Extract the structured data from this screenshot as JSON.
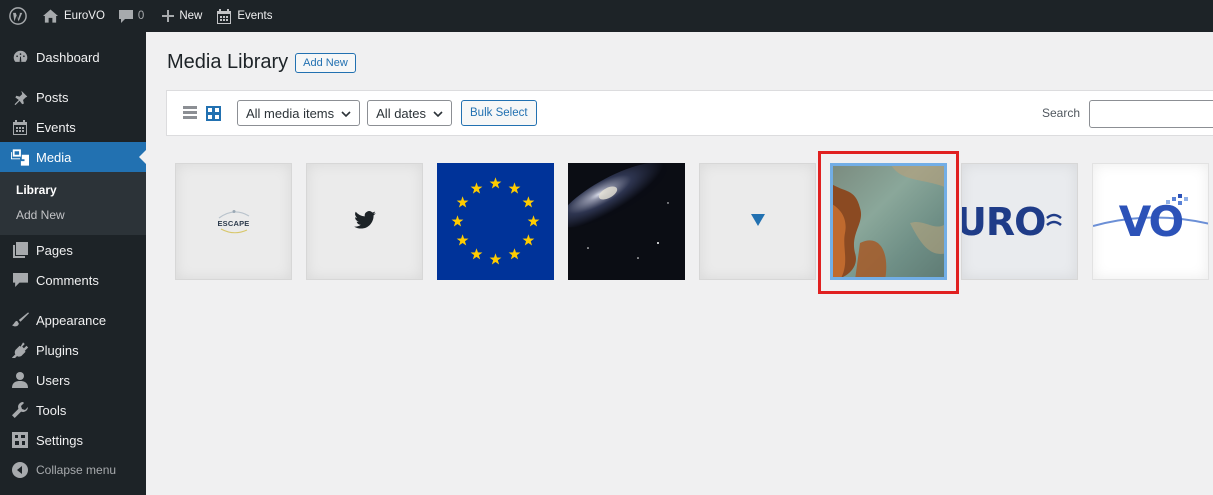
{
  "admin_bar": {
    "site_name": "EuroVO",
    "comments_count": "0",
    "new_label": "New",
    "events_label": "Events"
  },
  "sidebar": {
    "items": [
      {
        "label": "Dashboard",
        "icon": "dashboard-icon"
      },
      {
        "label": "Posts",
        "icon": "pin-icon"
      },
      {
        "label": "Events",
        "icon": "calendar-icon"
      },
      {
        "label": "Media",
        "icon": "media-icon"
      },
      {
        "label": "Pages",
        "icon": "page-icon"
      },
      {
        "label": "Comments",
        "icon": "comment-icon"
      },
      {
        "label": "Appearance",
        "icon": "brush-icon"
      },
      {
        "label": "Plugins",
        "icon": "plugin-icon"
      },
      {
        "label": "Users",
        "icon": "users-icon"
      },
      {
        "label": "Tools",
        "icon": "wrench-icon"
      },
      {
        "label": "Settings",
        "icon": "settings-icon"
      }
    ],
    "submenu": [
      "Library",
      "Add New"
    ],
    "collapse_label": "Collapse menu"
  },
  "main": {
    "title": "Media Library",
    "add_new": "Add New"
  },
  "toolbar": {
    "filter_type": "All media items",
    "filter_date": "All dates",
    "bulk_select": "Bulk Select",
    "search_label": "Search",
    "search_value": ""
  },
  "media_items": [
    {
      "kind": "ESCAPE logo",
      "logo_text": "ESCAPE"
    },
    {
      "kind": "twitter icon"
    },
    {
      "kind": "EU flag"
    },
    {
      "kind": "galaxy image"
    },
    {
      "kind": "file icon"
    },
    {
      "kind": "nebula image",
      "selected": true
    },
    {
      "kind": "EuroVO logo part",
      "logo_text": "URO"
    },
    {
      "kind": "VO logo",
      "logo_text": "VO"
    }
  ],
  "colors": {
    "admin_dark": "#1d2327",
    "accent": "#2271b1",
    "highlight_box": "#e02020",
    "selection": "#72aee6"
  }
}
